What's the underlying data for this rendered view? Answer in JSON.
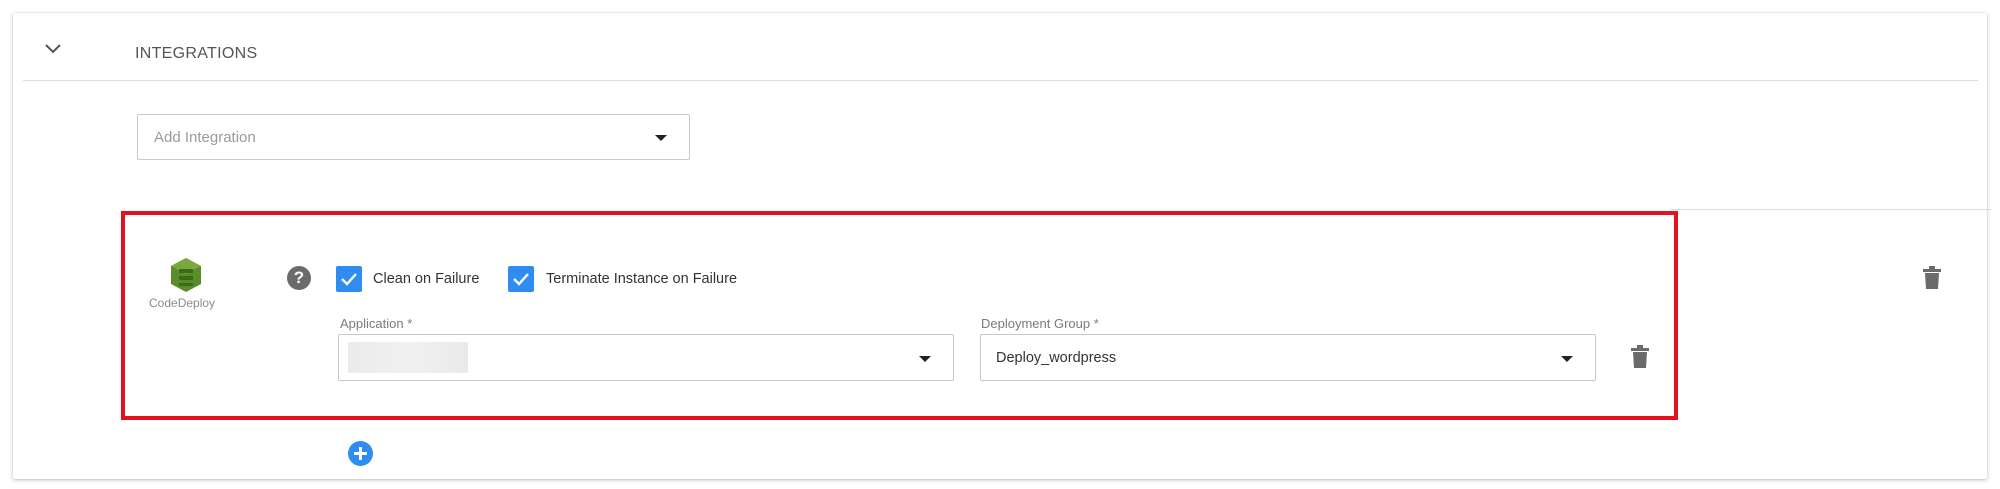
{
  "section": {
    "title": "INTEGRATIONS"
  },
  "add_integration": {
    "placeholder": "Add Integration"
  },
  "integration": {
    "name": "CodeDeploy",
    "clean_on_failure": {
      "label": "Clean on Failure",
      "checked": true
    },
    "terminate_on_failure": {
      "label": "Terminate Instance on Failure",
      "checked": true
    },
    "application": {
      "label": "Application *",
      "value": ""
    },
    "deployment_group": {
      "label": "Deployment Group *",
      "value": "Deploy_wordpress"
    }
  },
  "colors": {
    "accent": "#2f8df2",
    "highlight": "#e3121d",
    "codedeploy_green": "#5a8c2b"
  },
  "icons": {
    "collapse": "chevron-down-icon",
    "help": "question-circle-icon",
    "delete": "trash-icon",
    "add": "plus-circle-icon",
    "dropdown": "caret-down-icon"
  }
}
